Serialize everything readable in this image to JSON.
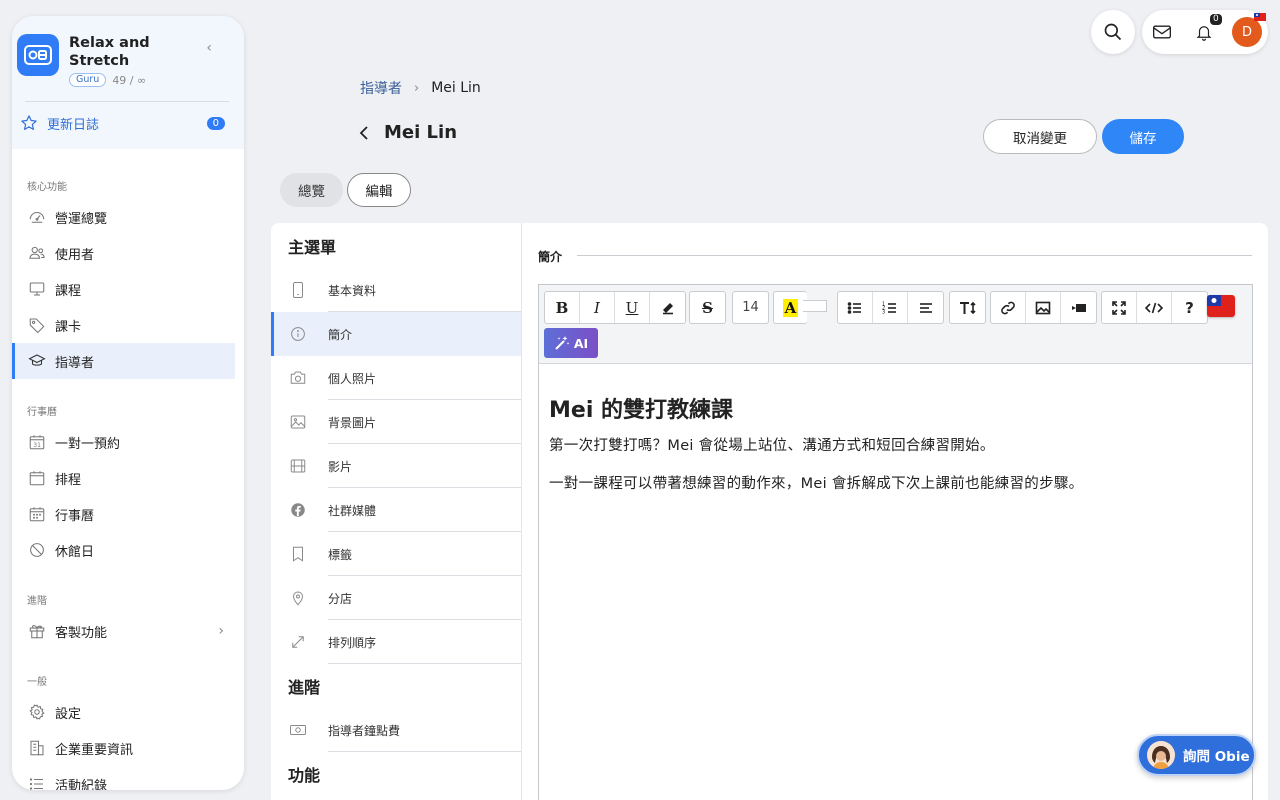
{
  "brand": {
    "name": "Relax and Stretch",
    "tier": "Guru",
    "quota": "49 / ∞"
  },
  "changelog": {
    "label": "更新日誌",
    "count": "0"
  },
  "sidebar": {
    "sections": [
      {
        "label": "核心功能",
        "items": [
          {
            "label": "營運總覽",
            "icon": "dashboard-icon"
          },
          {
            "label": "使用者",
            "icon": "users-icon"
          },
          {
            "label": "課程",
            "icon": "course-icon"
          },
          {
            "label": "課卡",
            "icon": "tag-icon"
          },
          {
            "label": "指導者",
            "icon": "graduation-cap-icon",
            "active": true
          }
        ]
      },
      {
        "label": "行事曆",
        "items": [
          {
            "label": "一對一預約",
            "icon": "calendar-31-icon"
          },
          {
            "label": "排程",
            "icon": "schedule-icon"
          },
          {
            "label": "行事曆",
            "icon": "calendar-icon"
          },
          {
            "label": "休館日",
            "icon": "ban-icon"
          }
        ]
      },
      {
        "label": "進階",
        "items": [
          {
            "label": "客製功能",
            "icon": "gift-icon"
          }
        ]
      },
      {
        "label": "一般",
        "items": [
          {
            "label": "設定",
            "icon": "gear-icon"
          },
          {
            "label": "企業重要資訊",
            "icon": "building-icon"
          },
          {
            "label": "活動紀錄",
            "icon": "list-icon"
          }
        ]
      }
    ]
  },
  "topbar": {
    "notification_count": "0",
    "avatar_initial": "D"
  },
  "breadcrumb": {
    "parent": "指導者",
    "current": "Mei Lin"
  },
  "page": {
    "title": "Mei Lin",
    "cancel_label": "取消變更",
    "save_label": "儲存"
  },
  "tabs": {
    "overview": "總覽",
    "edit": "編輯"
  },
  "menu": {
    "main_title": "主選單",
    "main_items": [
      {
        "label": "基本資料",
        "icon": "phone-icon"
      },
      {
        "label": "簡介",
        "icon": "info-icon",
        "active": true
      },
      {
        "label": "個人照片",
        "icon": "camera-icon"
      },
      {
        "label": "背景圖片",
        "icon": "image-icon"
      },
      {
        "label": "影片",
        "icon": "film-icon"
      },
      {
        "label": "社群媒體",
        "icon": "facebook-icon"
      },
      {
        "label": "標籤",
        "icon": "bookmark-icon"
      },
      {
        "label": "分店",
        "icon": "location-pin-icon"
      },
      {
        "label": "排列順序",
        "icon": "arrows-icon"
      }
    ],
    "advanced_title": "進階",
    "advanced_items": [
      {
        "label": "指導者鐘點費",
        "icon": "money-icon"
      }
    ],
    "features_title": "功能"
  },
  "editor": {
    "section_title": "簡介",
    "font_size": "14",
    "highlight_letter": "A",
    "ai_label": "AI",
    "heading": "Mei 的雙打教練課",
    "paragraphs": [
      "第一次打雙打嗎？Mei 會從場上站位、溝通方式和短回合練習開始。",
      "一對一課程可以帶著想練習的動作來，Mei 會拆解成下次上課前也能練習的步驟。"
    ]
  },
  "obie": {
    "label": "詢問 Obie"
  },
  "colors": {
    "accent": "#2f7cf6",
    "save": "#2f86f6",
    "avatar": "#e25a1c"
  }
}
